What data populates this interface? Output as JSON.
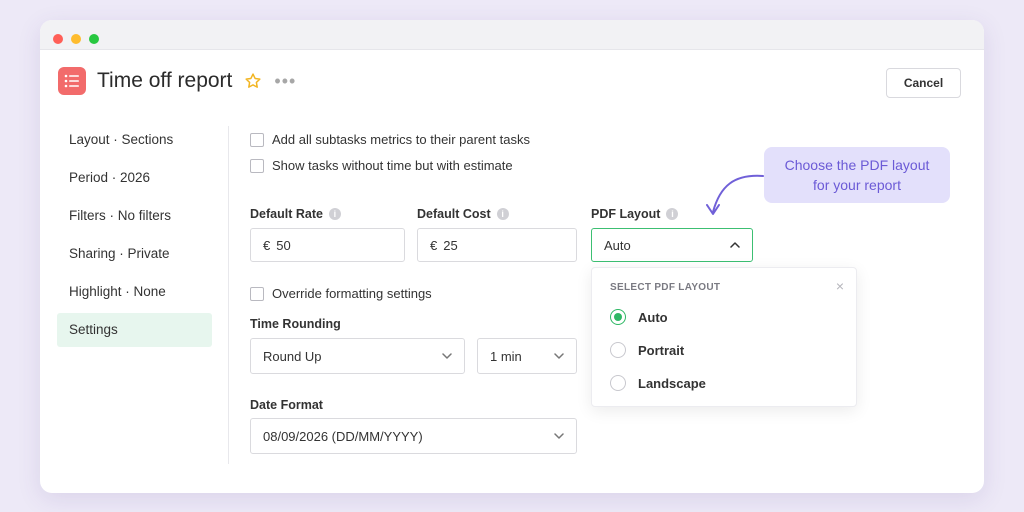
{
  "header": {
    "title": "Time off report",
    "star_icon": "star-icon",
    "more_label": "•••",
    "cancel_label": "Cancel"
  },
  "sidebar": {
    "items": [
      {
        "label": "Layout · Sections"
      },
      {
        "label": "Period · 2026"
      },
      {
        "label": "Filters · No filters"
      },
      {
        "label": "Sharing · Private"
      },
      {
        "label": "Highlight · None"
      },
      {
        "label": "Settings",
        "active": true
      }
    ]
  },
  "settings": {
    "checkbox_subtasks": "Add all subtasks metrics to their parent tasks",
    "checkbox_no_time": "Show tasks without time but with estimate",
    "default_rate": {
      "label": "Default Rate",
      "currency": "€",
      "value": "50"
    },
    "default_cost": {
      "label": "Default Cost",
      "currency": "€",
      "value": "25"
    },
    "pdf_layout": {
      "label": "PDF Layout",
      "value": "Auto"
    },
    "override_formatting": "Override formatting settings",
    "time_rounding": {
      "label": "Time Rounding",
      "mode": "Round Up",
      "interval": "1 min"
    },
    "date_format": {
      "label": "Date Format",
      "value": "08/09/2026 (DD/MM/YYYY)"
    }
  },
  "dropdown": {
    "title": "SELECT PDF LAYOUT",
    "close_label": "×",
    "options": [
      {
        "label": "Auto",
        "selected": true
      },
      {
        "label": "Portrait",
        "selected": false
      },
      {
        "label": "Landscape",
        "selected": false
      }
    ]
  },
  "tooltip": {
    "line1": "Choose the PDF layout",
    "line2": "for your report"
  },
  "colors": {
    "background": "#ede9f7",
    "accent_green": "#2fb865",
    "app_icon": "#f26b6b",
    "tooltip_bg": "#e3e0fb",
    "tooltip_text": "#6b5ad6"
  }
}
